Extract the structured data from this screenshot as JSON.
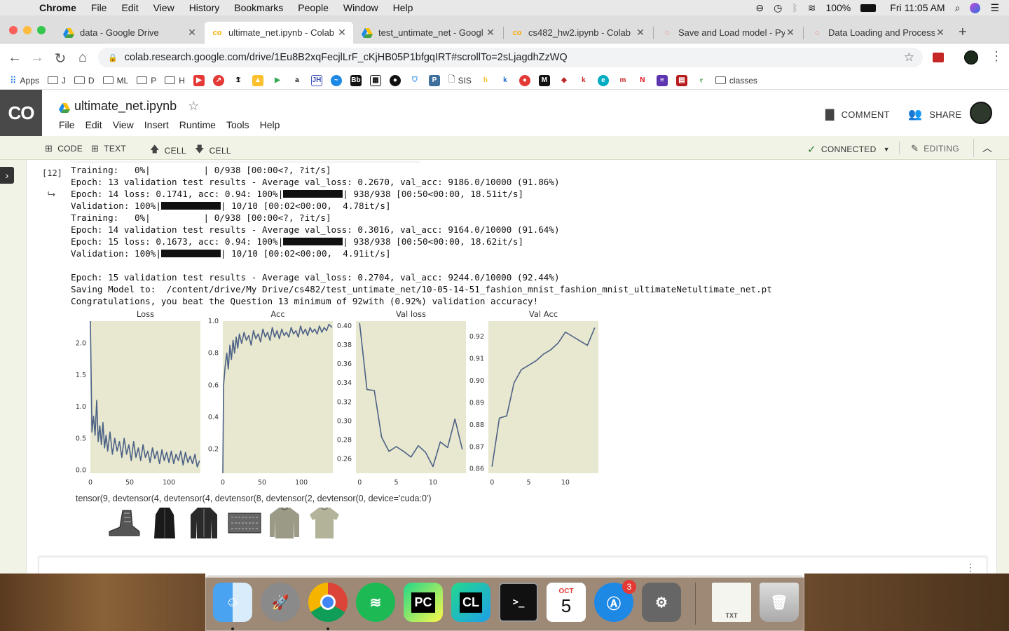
{
  "menubar": {
    "app": "Chrome",
    "items": [
      "File",
      "Edit",
      "View",
      "History",
      "Bookmarks",
      "People",
      "Window",
      "Help"
    ],
    "battery": "100%",
    "clock": "Fri 11:05 AM"
  },
  "tabs": [
    {
      "title": "data - Google Drive",
      "icon": "drive-icon"
    },
    {
      "title": "ultimate_net.ipynb - Colab",
      "icon": "colab-icon"
    },
    {
      "title": "test_untimate_net - Googl",
      "icon": "drive-icon"
    },
    {
      "title": "cs482_hw2.ipynb - Colab",
      "icon": "colab-icon"
    },
    {
      "title": "Save and Load model - Py",
      "icon": "pytorch-icon"
    },
    {
      "title": "Data Loading and Process",
      "icon": "pytorch-icon"
    }
  ],
  "url": "colab.research.google.com/drive/1Eu8B2xqFecjlLrF_cKjHB05P1bfgqIRT#scrollTo=2sLjagdhZzWQ",
  "bookmarks": {
    "apps": "Apps",
    "folders": [
      "J",
      "D",
      "ML",
      "P",
      "H"
    ],
    "sis": "SIS",
    "classes": "classes"
  },
  "colab": {
    "logo": "CO",
    "title": "ultimate_net.ipynb",
    "menu": [
      "File",
      "Edit",
      "View",
      "Insert",
      "Runtime",
      "Tools",
      "Help"
    ],
    "comment": "COMMENT",
    "share": "SHARE",
    "toolbar": {
      "code": "CODE",
      "text": "TEXT",
      "cell_up": "CELL",
      "cell_down": "CELL",
      "connected": "CONNECTED",
      "editing": "EDITING"
    }
  },
  "cell": {
    "exec_count": "[12]",
    "output_lines": [
      "Training:   0%|          | 0/938 [00:00<?, ?it/s]",
      "Epoch: 13 validation test results - Average val_loss: 0.2670, val_acc: 9186.0/10000 (91.86%)",
      "Epoch: 14 loss: 0.1741, acc: 0.94: 100%|",
      "| 938/938 [00:50<00:00, 18.51it/s]",
      "Validation: 100%|",
      "| 10/10 [00:02<00:00,  4.78it/s]",
      "Training:   0%|          | 0/938 [00:00<?, ?it/s]",
      "Epoch: 14 validation test results - Average val_loss: 0.3016, val_acc: 9164.0/10000 (91.64%)",
      "Epoch: 15 loss: 0.1673, acc: 0.94: 100%|",
      "| 938/938 [00:50<00:00, 18.62it/s]",
      "Validation: 100%|",
      "| 10/10 [00:02<00:00,  4.91it/s]",
      "Epoch: 15 validation test results - Average val_loss: 0.2704, val_acc: 9244.0/10000 (92.44%)",
      "Saving Model to:  /content/drive/My Drive/cs482/test_untimate_net/10-05-14-51_fashion_mnist_fashion_mnist_ultimateNetultimate_net.pt",
      "Congratulations, you beat the Question 13 minimum of 92with (0.92%) validation accuracy!"
    ],
    "tensor_text": "tensor(9, devtensor(4, devtensor(4, devtensor(8, devtensor(2, devtensor(0, device='cuda:0')"
  },
  "chart_data": [
    {
      "type": "line",
      "title": "Loss",
      "xlim": [
        0,
        140
      ],
      "ylim": [
        -0.05,
        2.35
      ],
      "xticks": [
        "0",
        "50",
        "100"
      ],
      "yticks": [
        "0.0",
        "0.5",
        "1.0",
        "1.5",
        "2.0"
      ],
      "ytick_values": [
        0,
        0.5,
        1,
        1.5,
        2
      ],
      "xtick_values": [
        0,
        50,
        100
      ],
      "x": [
        0,
        2,
        4,
        6,
        8,
        10,
        12,
        14,
        16,
        18,
        20,
        22,
        25,
        28,
        31,
        34,
        37,
        40,
        43,
        46,
        49,
        52,
        55,
        58,
        61,
        64,
        67,
        70,
        73,
        76,
        79,
        82,
        85,
        88,
        91,
        94,
        97,
        100,
        103,
        106,
        109,
        112,
        115,
        118,
        121,
        124,
        127,
        130,
        133,
        136,
        139
      ],
      "y": [
        2.35,
        0.6,
        0.85,
        0.55,
        1.1,
        0.45,
        0.7,
        0.4,
        0.75,
        0.35,
        0.55,
        0.3,
        0.6,
        0.25,
        0.5,
        0.3,
        0.45,
        0.2,
        0.5,
        0.25,
        0.4,
        0.15,
        0.45,
        0.2,
        0.35,
        0.15,
        0.4,
        0.2,
        0.3,
        0.12,
        0.35,
        0.18,
        0.3,
        0.1,
        0.32,
        0.15,
        0.28,
        0.12,
        0.3,
        0.1,
        0.25,
        0.15,
        0.3,
        0.08,
        0.28,
        0.12,
        0.22,
        0.1,
        0.25,
        0.05,
        0.15
      ],
      "color": "#4c6185"
    },
    {
      "type": "line",
      "title": "Acc",
      "xlim": [
        0,
        140
      ],
      "ylim": [
        0.05,
        1.0
      ],
      "xticks": [
        "0",
        "50",
        "100"
      ],
      "yticks": [
        "0.2",
        "0.4",
        "0.6",
        "0.8",
        "1.0"
      ],
      "ytick_values": [
        0.2,
        0.4,
        0.6,
        0.8,
        1.0
      ],
      "xtick_values": [
        0,
        50,
        100
      ],
      "x": [
        0,
        1,
        3,
        5,
        7,
        9,
        11,
        13,
        15,
        17,
        19,
        21,
        24,
        27,
        30,
        33,
        36,
        39,
        42,
        45,
        48,
        51,
        54,
        57,
        60,
        63,
        66,
        69,
        72,
        75,
        78,
        81,
        84,
        87,
        90,
        93,
        96,
        99,
        102,
        105,
        108,
        111,
        114,
        117,
        120,
        123,
        126,
        129,
        132,
        135,
        139
      ],
      "y": [
        0.05,
        0.6,
        0.72,
        0.8,
        0.7,
        0.85,
        0.76,
        0.88,
        0.8,
        0.9,
        0.83,
        0.92,
        0.86,
        0.93,
        0.88,
        0.91,
        0.85,
        0.94,
        0.89,
        0.92,
        0.87,
        0.95,
        0.9,
        0.93,
        0.88,
        0.96,
        0.9,
        0.94,
        0.89,
        0.95,
        0.91,
        0.93,
        0.9,
        0.96,
        0.92,
        0.94,
        0.9,
        0.97,
        0.92,
        0.95,
        0.91,
        0.96,
        0.93,
        0.95,
        0.92,
        0.97,
        0.93,
        0.96,
        0.94,
        0.98,
        0.96
      ],
      "color": "#4c6185"
    },
    {
      "type": "line",
      "title": "Val loss",
      "xlim": [
        -0.5,
        14.5
      ],
      "ylim": [
        0.245,
        0.405
      ],
      "xticks": [
        "0",
        "5",
        "10"
      ],
      "yticks": [
        "0.26",
        "0.28",
        "0.30",
        "0.32",
        "0.34",
        "0.36",
        "0.38",
        "0.40"
      ],
      "ytick_values": [
        0.26,
        0.28,
        0.3,
        0.32,
        0.34,
        0.36,
        0.38,
        0.4
      ],
      "xtick_values": [
        0,
        5,
        10
      ],
      "x": [
        0,
        1,
        2,
        3,
        4,
        5,
        6,
        7,
        8,
        9,
        10,
        11,
        12,
        13,
        14
      ],
      "y": [
        0.403,
        0.333,
        0.332,
        0.283,
        0.268,
        0.273,
        0.268,
        0.262,
        0.274,
        0.267,
        0.252,
        0.278,
        0.272,
        0.302,
        0.27
      ],
      "color": "#4c6185"
    },
    {
      "type": "line",
      "title": "Val Acc",
      "xlim": [
        -0.5,
        14.5
      ],
      "ylim": [
        0.858,
        0.927
      ],
      "xticks": [
        "0",
        "5",
        "10"
      ],
      "yticks": [
        "0.86",
        "0.87",
        "0.88",
        "0.89",
        "0.90",
        "0.91",
        "0.92"
      ],
      "ytick_values": [
        0.86,
        0.87,
        0.88,
        0.89,
        0.9,
        0.91,
        0.92
      ],
      "xtick_values": [
        0,
        5,
        10
      ],
      "x": [
        0,
        1,
        2,
        3,
        4,
        5,
        6,
        7,
        8,
        9,
        10,
        11,
        12,
        13,
        14
      ],
      "y": [
        0.861,
        0.883,
        0.884,
        0.899,
        0.905,
        0.907,
        0.909,
        0.912,
        0.914,
        0.917,
        0.922,
        0.92,
        0.918,
        0.916,
        0.924
      ],
      "color": "#4c6185"
    }
  ],
  "dock": {
    "calendar_month": "OCT",
    "calendar_day": "5",
    "appstore_badge": "3",
    "txt_label": "TXT"
  }
}
